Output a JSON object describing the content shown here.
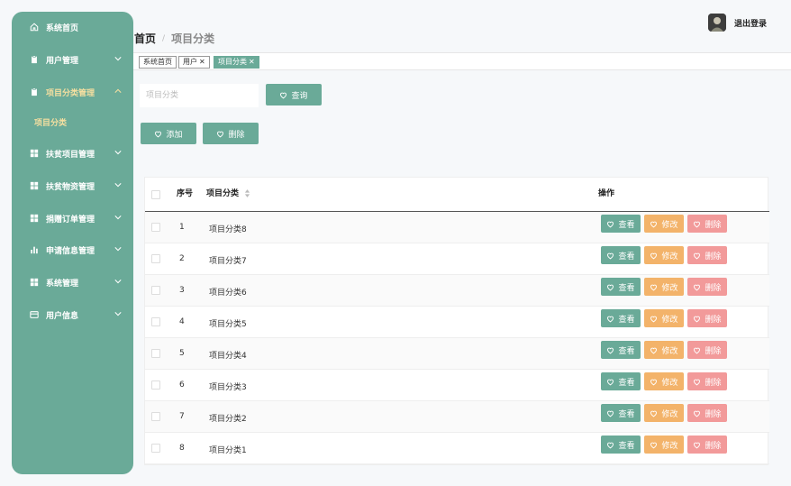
{
  "sidebar": {
    "items": [
      {
        "label": "系统首页",
        "icon": "home-icon",
        "has_arrow": false,
        "expanded": false,
        "active": false
      },
      {
        "label": "用户管理",
        "icon": "clipboard-icon",
        "has_arrow": true,
        "expanded": false,
        "active": false
      },
      {
        "label": "项目分类管理",
        "icon": "clipboard-icon",
        "has_arrow": true,
        "expanded": true,
        "active": true
      },
      {
        "label": "扶贫项目管理",
        "icon": "grid-icon",
        "has_arrow": true,
        "expanded": false,
        "active": false
      },
      {
        "label": "扶贫物资管理",
        "icon": "grid-icon",
        "has_arrow": true,
        "expanded": false,
        "active": false
      },
      {
        "label": "捐赠订单管理",
        "icon": "grid-icon",
        "has_arrow": true,
        "expanded": false,
        "active": false
      },
      {
        "label": "申请信息管理",
        "icon": "bar-chart-icon",
        "has_arrow": true,
        "expanded": false,
        "active": false
      },
      {
        "label": "系统管理",
        "icon": "grid-icon",
        "has_arrow": true,
        "expanded": false,
        "active": false
      },
      {
        "label": "用户信息",
        "icon": "card-icon",
        "has_arrow": true,
        "expanded": false,
        "active": false
      }
    ],
    "sub_item": "项目分类"
  },
  "header": {
    "logout_label": "退出登录",
    "breadcrumb_home": "首页",
    "breadcrumb_sep": "/",
    "breadcrumb_current": "项目分类"
  },
  "tags": [
    {
      "label": "系统首页",
      "closable": false,
      "active": false
    },
    {
      "label": "用户",
      "closable": true,
      "active": false
    },
    {
      "label": "项目分类",
      "closable": true,
      "active": true
    }
  ],
  "search": {
    "placeholder": "项目分类",
    "query_label": "查询"
  },
  "actions": {
    "add_label": "添加",
    "delete_label": "删除"
  },
  "table": {
    "headers": {
      "index": "序号",
      "name": "项目分类",
      "ops": "操作"
    },
    "row_buttons": {
      "view": "查看",
      "edit": "修改",
      "delete": "删除"
    },
    "rows": [
      {
        "index": "1",
        "name": "项目分类8"
      },
      {
        "index": "2",
        "name": "项目分类7"
      },
      {
        "index": "3",
        "name": "项目分类6"
      },
      {
        "index": "4",
        "name": "项目分类5"
      },
      {
        "index": "5",
        "name": "项目分类4"
      },
      {
        "index": "6",
        "name": "项目分类3"
      },
      {
        "index": "7",
        "name": "项目分类2"
      },
      {
        "index": "8",
        "name": "项目分类1"
      }
    ]
  },
  "colors": {
    "primary": "#6aaa98",
    "warning": "#f3b36a",
    "danger": "#f29a9a",
    "sub_active": "#f5dfa0"
  }
}
